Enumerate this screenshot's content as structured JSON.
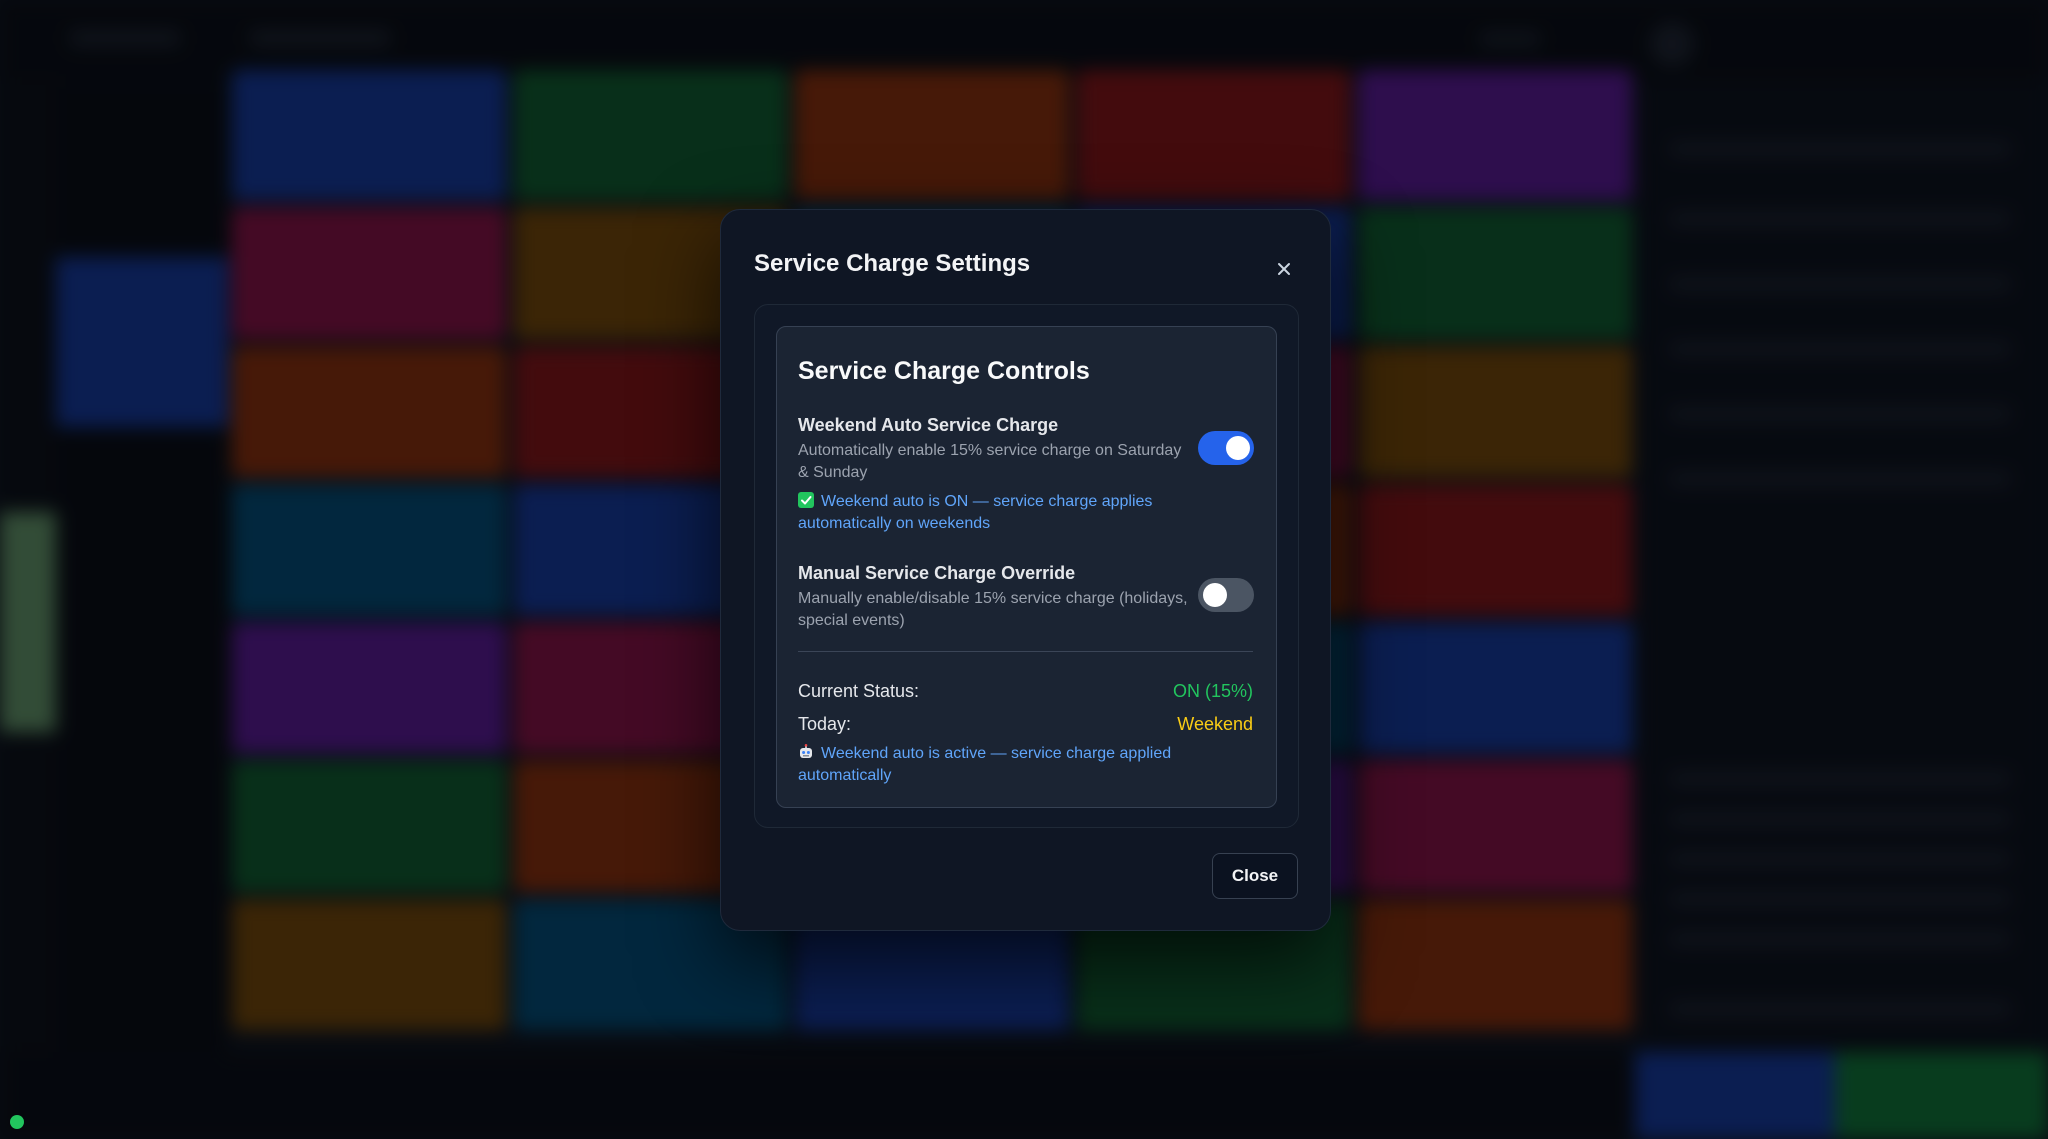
{
  "modal": {
    "title": "Service Charge Settings",
    "close_icon": "close-icon",
    "close_button_label": "Close"
  },
  "controls": {
    "title": "Service Charge Controls",
    "weekend": {
      "title": "Weekend Auto Service Charge",
      "description": "Automatically enable 15% service charge on Saturday & Sunday",
      "enabled": true,
      "note_icon": "check-icon",
      "note": "Weekend auto is ON — service charge applies automatically on weekends"
    },
    "manual": {
      "title": "Manual Service Charge Override",
      "description": "Manually enable/disable 15% service charge (holidays, special events)",
      "enabled": false
    },
    "status": {
      "current_label": "Current Status:",
      "current_value": "ON (15%)",
      "current_color": "#22c55e",
      "today_label": "Today:",
      "today_value": "Weekend",
      "today_color": "#facc15",
      "note_icon": "robot-icon",
      "note": "Weekend auto is active — service charge applied automatically"
    }
  },
  "colors": {
    "accent": "#2563eb",
    "link": "#60a5fa",
    "tile_palette": [
      "#1d4ed8",
      "#15803d",
      "#c2410c",
      "#b91c1c",
      "#7e22ce",
      "#be185d",
      "#a16207",
      "#0369a1"
    ]
  }
}
